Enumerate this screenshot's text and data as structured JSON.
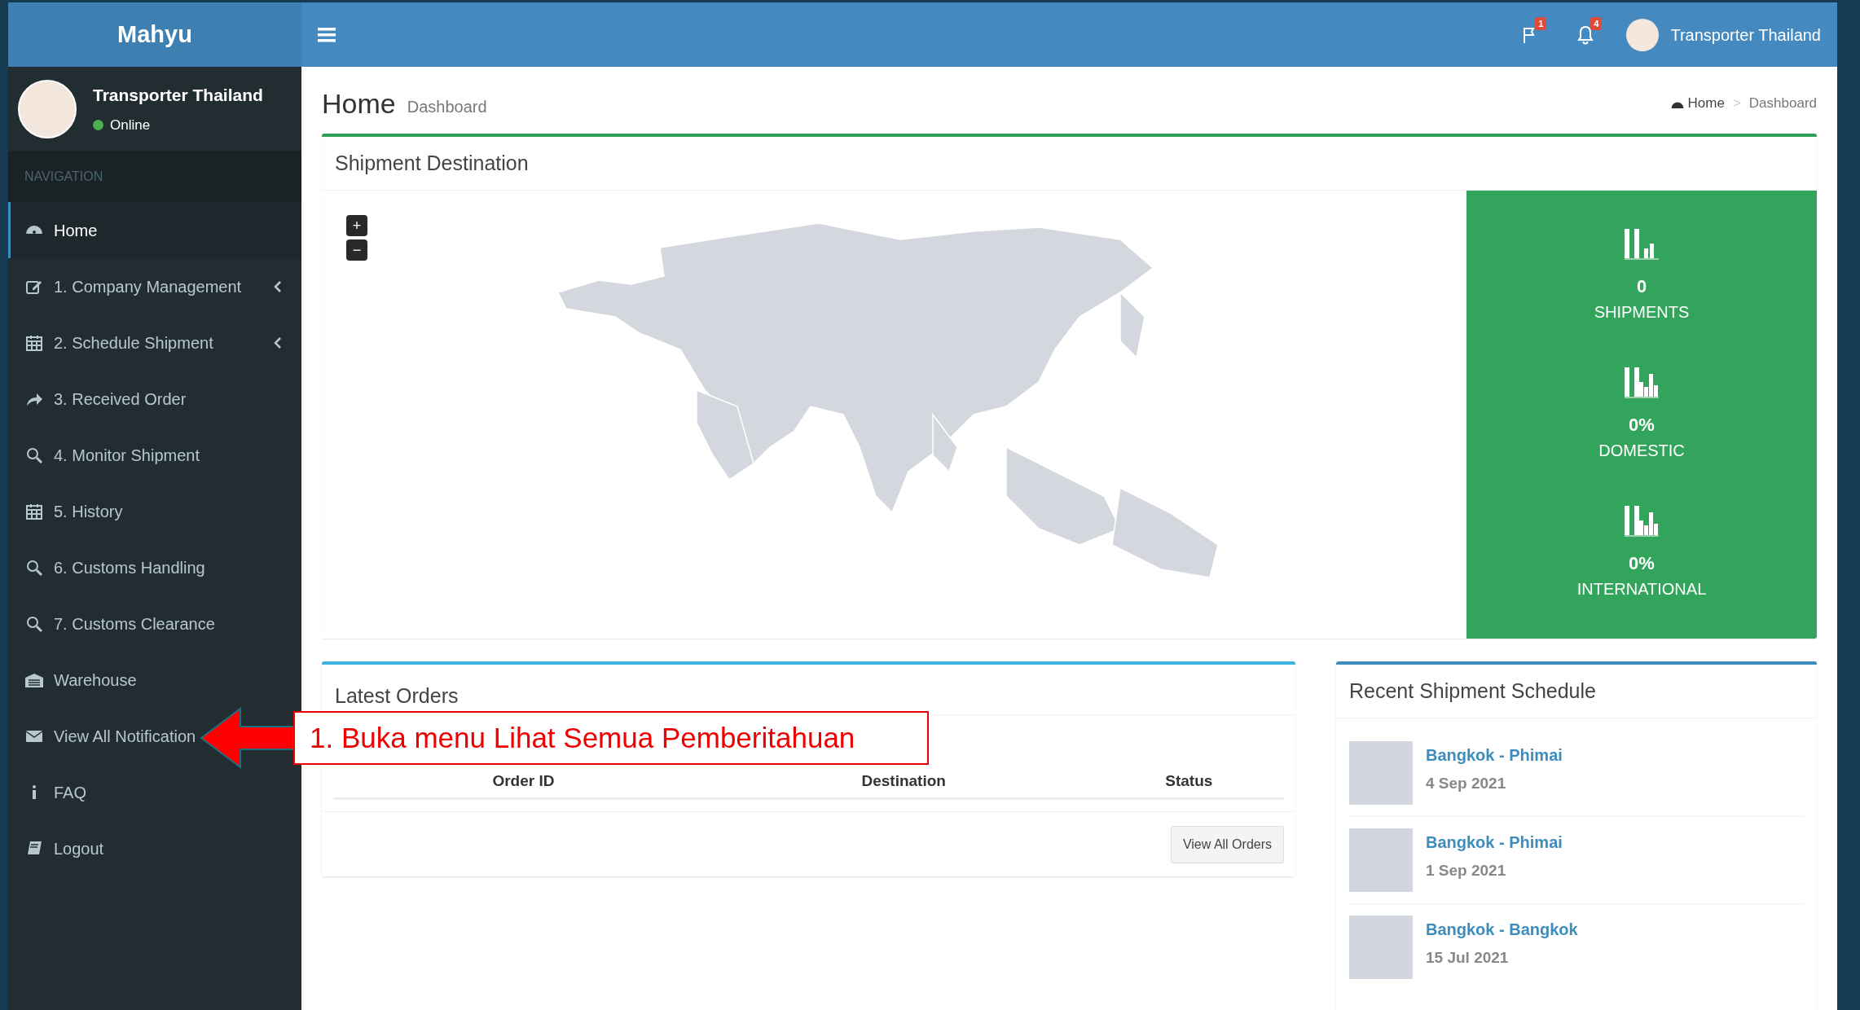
{
  "header": {
    "brand": "Mahyu",
    "flag_badge": "1",
    "bell_badge": "4",
    "user_name": "Transporter Thailand"
  },
  "sidebar": {
    "user": {
      "name": "Transporter Thailand",
      "status": "Online"
    },
    "nav_header": "NAVIGATION",
    "items": [
      {
        "label": "Home",
        "has_submenu": false,
        "selected": true
      },
      {
        "label": "1. Company Management",
        "has_submenu": true,
        "selected": false
      },
      {
        "label": "2. Schedule Shipment",
        "has_submenu": true,
        "selected": false
      },
      {
        "label": "3. Received Order",
        "has_submenu": false,
        "selected": false
      },
      {
        "label": "4. Monitor Shipment",
        "has_submenu": false,
        "selected": false
      },
      {
        "label": "5. History",
        "has_submenu": false,
        "selected": false
      },
      {
        "label": "6. Customs Handling",
        "has_submenu": false,
        "selected": false
      },
      {
        "label": "7. Customs Clearance",
        "has_submenu": false,
        "selected": false
      },
      {
        "label": "Warehouse",
        "has_submenu": false,
        "selected": false
      },
      {
        "label": "View All Notification",
        "has_submenu": false,
        "selected": false
      },
      {
        "label": "FAQ",
        "has_submenu": false,
        "selected": false
      },
      {
        "label": "Logout",
        "has_submenu": false,
        "selected": false
      }
    ]
  },
  "page_header": {
    "title": "Home",
    "subtitle": "Dashboard",
    "breadcrumb": [
      "Home",
      "Dashboard"
    ],
    "separator": ">"
  },
  "shipment_destination": {
    "title": "Shipment Destination",
    "zoom_in": "+",
    "zoom_out": "−",
    "stats": [
      {
        "value": "0",
        "label": "SHIPMENTS"
      },
      {
        "value": "0%",
        "label": "DOMESTIC"
      },
      {
        "value": "0%",
        "label": "INTERNATIONAL"
      }
    ]
  },
  "latest_orders": {
    "title": "Latest Orders",
    "columns": [
      "Order ID",
      "Destination",
      "Status"
    ],
    "button": "View All Orders"
  },
  "recent_schedule": {
    "title": "Recent Shipment Schedule",
    "items": [
      {
        "route": "Bangkok - Phimai",
        "date": "4 Sep 2021"
      },
      {
        "route": "Bangkok - Phimai",
        "date": "1 Sep 2021"
      },
      {
        "route": "Bangkok - Bangkok",
        "date": "15 Jul 2021"
      }
    ]
  },
  "annotation": {
    "text": "1. Buka menu Lihat Semua Pemberitahuan"
  }
}
